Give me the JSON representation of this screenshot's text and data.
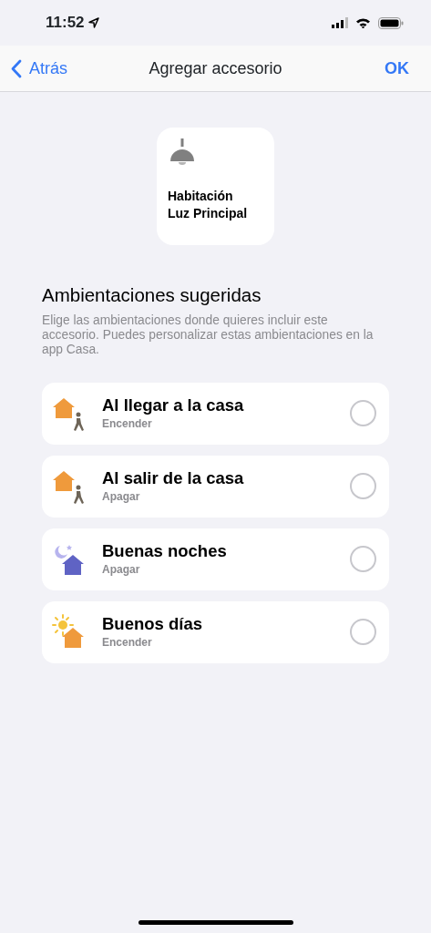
{
  "status_bar": {
    "time": "11:52"
  },
  "nav": {
    "back": "Atrás",
    "title": "Agregar accesorio",
    "done": "OK"
  },
  "accessory": {
    "room": "Habitación",
    "name": "Luz Principal"
  },
  "section": {
    "title": "Ambientaciones sugeridas",
    "description": "Elige las ambientaciones donde quieres incluir este accesorio. Puedes personalizar estas ambientaciones en la app Casa."
  },
  "scenes": [
    {
      "kind": "arrive",
      "name": "Al llegar a la casa",
      "action": "Encender",
      "selected": false
    },
    {
      "kind": "leave",
      "name": "Al salir de la casa",
      "action": "Apagar",
      "selected": false
    },
    {
      "kind": "night",
      "name": "Buenas noches",
      "action": "Apagar",
      "selected": false
    },
    {
      "kind": "morning",
      "name": "Buenos días",
      "action": "Encender",
      "selected": false
    }
  ]
}
